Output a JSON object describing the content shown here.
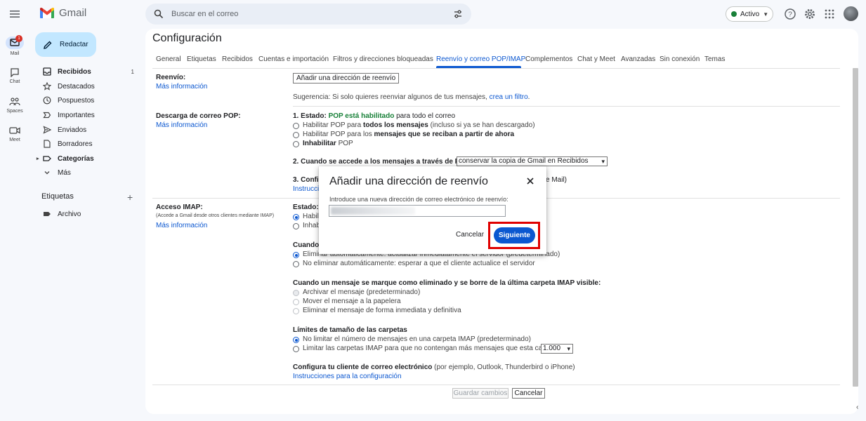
{
  "app": {
    "name": "Gmail"
  },
  "search": {
    "placeholder": "Buscar en el correo"
  },
  "status": {
    "label": "Activo",
    "color": "#188038"
  },
  "rail": {
    "mail": {
      "label": "Mail",
      "badge": "1"
    },
    "chat": {
      "label": "Chat"
    },
    "spaces": {
      "label": "Spaces"
    },
    "meet": {
      "label": "Meet"
    }
  },
  "compose": {
    "label": "Redactar"
  },
  "nav": {
    "items": [
      {
        "label": "Recibidos",
        "count": "1",
        "icon": "inbox-icon"
      },
      {
        "label": "Destacados",
        "icon": "star-icon"
      },
      {
        "label": "Pospuestos",
        "icon": "clock-icon"
      },
      {
        "label": "Importantes",
        "icon": "important-icon"
      },
      {
        "label": "Enviados",
        "icon": "send-icon"
      },
      {
        "label": "Borradores",
        "icon": "draft-icon"
      },
      {
        "label": "Categorías",
        "icon": "label-icon"
      },
      {
        "label": "Más",
        "icon": "chevron-down-icon"
      }
    ],
    "labels_title": "Etiquetas",
    "labels": [
      {
        "label": "Archivo"
      }
    ]
  },
  "settings": {
    "title": "Configuración",
    "tabs": [
      "General",
      "Etiquetas",
      "Recibidos",
      "Cuentas e importación",
      "Filtros y direcciones bloqueadas",
      "Reenvío y correo POP/IMAP",
      "Complementos",
      "Chat y Meet",
      "Avanzadas",
      "Sin conexión",
      "Temas"
    ],
    "active_tab": "Reenvío y correo POP/IMAP",
    "forwarding": {
      "label": "Reenvío:",
      "more_info": "Más información",
      "add_button": "Añadir una dirección de reenvío",
      "tip_prefix": "Sugerencia: Si solo quieres reenviar algunos de tus mensajes,",
      "tip_link": "crea un filtro",
      "tip_suffix": "."
    },
    "pop": {
      "label": "Descarga de correo POP:",
      "more_info": "Más información",
      "status_prefix": "1. Estado:",
      "status_value": "POP está habilitado",
      "status_suffix": "para todo el correo",
      "option1": [
        "Habilitar POP para",
        "todos los mensajes",
        "(incluso si ya se han descargado)"
      ],
      "option2": [
        "Habilitar POP para los",
        "mensajes que se reciban a partir de ahora"
      ],
      "option3": [
        "Inhabilitar",
        "POP"
      ],
      "step2": "2. Cuando se accede a los mensajes a través de POP",
      "step2_select": "conservar la copia de Gmail en Recibidos",
      "step3_prefix": "3. Config",
      "step3_suffix": "e Mail)",
      "step3_link": "Instruccio"
    },
    "imap": {
      "label": "Acceso IMAP:",
      "sublabel": "(Accede a Gmail desde otros clientes mediante IMAP)",
      "more_info": "Más información",
      "status": "Estado:",
      "enable": "Habilit",
      "disable": "Inhab",
      "when": "Cuando",
      "expunge_on": "Eliminar automáticamente: actualizar inmediatamente el servidor (predeterminado)",
      "expunge_off": "No eliminar automáticamente: esperar a que el cliente actualice el servidor",
      "deleted_title": "Cuando un mensaje se marque como eliminado y se borre de la última carpeta IMAP visible:",
      "deleted_opts": [
        "Archivar el mensaje (predeterminado)",
        "Mover el mensaje a la papelera",
        "Eliminar el mensaje de forma inmediata y definitiva"
      ],
      "limits_title": "Límites de tamaño de las carpetas",
      "limit_opt1": "No limitar el número de mensajes en una carpeta IMAP (predeterminado)",
      "limit_opt2": "Limitar las carpetas IMAP para que no contengan más mensajes que esta cantidad",
      "limit_value": "1.000",
      "client_bold": "Configura tu cliente de correo electrónico",
      "client_rest": "(por ejemplo, Outlook, Thunderbird o iPhone)",
      "client_link": "Instrucciones para la configuración"
    },
    "footer": {
      "save": "Guardar cambios",
      "cancel": "Cancelar"
    }
  },
  "dialog": {
    "title": "Añadir una dirección de reenvío",
    "input_label": "Introduce una nueva dirección de correo electrónico de reenvío:",
    "cancel": "Cancelar",
    "next": "Siguiente",
    "highlight_color": "#e00000"
  }
}
